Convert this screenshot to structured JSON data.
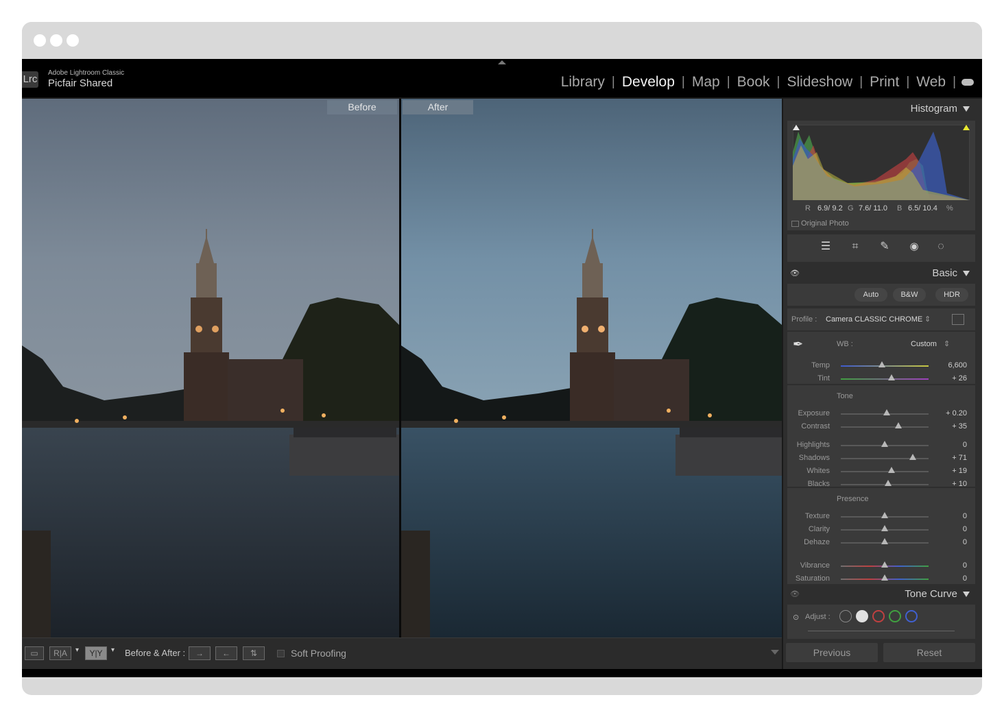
{
  "app": {
    "name": "Adobe Lightroom Classic",
    "catalog": "Picfair Shared",
    "logo_text": "Lrc"
  },
  "modules": [
    "Library",
    "Develop",
    "Map",
    "Book",
    "Slideshow",
    "Print",
    "Web"
  ],
  "active_module": "Develop",
  "viewer": {
    "before_label": "Before",
    "after_label": "After"
  },
  "toolbar": {
    "ra_label": "R|A",
    "yy_label": "Y|Y",
    "before_after_label": "Before & After :",
    "soft_proofing_label": "Soft Proofing"
  },
  "histogram": {
    "title": "Histogram",
    "readout": {
      "r_label": "R",
      "r_values": "6.9/ 9.2",
      "g_label": "G",
      "g_values": "7.6/ 11.0",
      "b_label": "B",
      "b_values": "6.5/ 10.4",
      "unit": "%"
    },
    "original_photo_label": "Original Photo"
  },
  "tools": [
    "edit-sliders-icon",
    "crop-icon",
    "healing-icon",
    "redeye-icon",
    "masking-icon"
  ],
  "basic": {
    "title": "Basic",
    "auto_label": "Auto",
    "bw_label": "B&W",
    "hdr_label": "HDR",
    "profile_label": "Profile :",
    "profile_value": "Camera CLASSIC CHROME",
    "wb_label": "WB :",
    "wb_value": "Custom",
    "wb_sliders": [
      {
        "label": "Temp",
        "value": "6,600",
        "pos": 0.47
      },
      {
        "label": "Tint",
        "value": "+ 26",
        "pos": 0.58
      }
    ],
    "tone_label": "Tone",
    "tone_sliders": [
      {
        "label": "Exposure",
        "value": "+ 0.20",
        "pos": 0.52
      },
      {
        "label": "Contrast",
        "value": "+ 35",
        "pos": 0.66
      }
    ],
    "tone2_sliders": [
      {
        "label": "Highlights",
        "value": "0",
        "pos": 0.5
      },
      {
        "label": "Shadows",
        "value": "+ 71",
        "pos": 0.82
      },
      {
        "label": "Whites",
        "value": "+ 19",
        "pos": 0.58
      },
      {
        "label": "Blacks",
        "value": "+ 10",
        "pos": 0.54
      }
    ],
    "presence_label": "Presence",
    "presence_sliders": [
      {
        "label": "Texture",
        "value": "0",
        "pos": 0.5
      },
      {
        "label": "Clarity",
        "value": "0",
        "pos": 0.5
      },
      {
        "label": "Dehaze",
        "value": "0",
        "pos": 0.5
      }
    ],
    "vib_sliders": [
      {
        "label": "Vibrance",
        "value": "0",
        "pos": 0.5
      },
      {
        "label": "Saturation",
        "value": "0",
        "pos": 0.5
      }
    ]
  },
  "tone_curve": {
    "title": "Tone Curve",
    "adjust_label": "Adjust :"
  },
  "footer": {
    "previous_label": "Previous",
    "reset_label": "Reset"
  },
  "colors": {
    "accent": "#6d7c8b",
    "panel_bg": "#2e2e2e",
    "section_bg": "#3a3a3a"
  }
}
